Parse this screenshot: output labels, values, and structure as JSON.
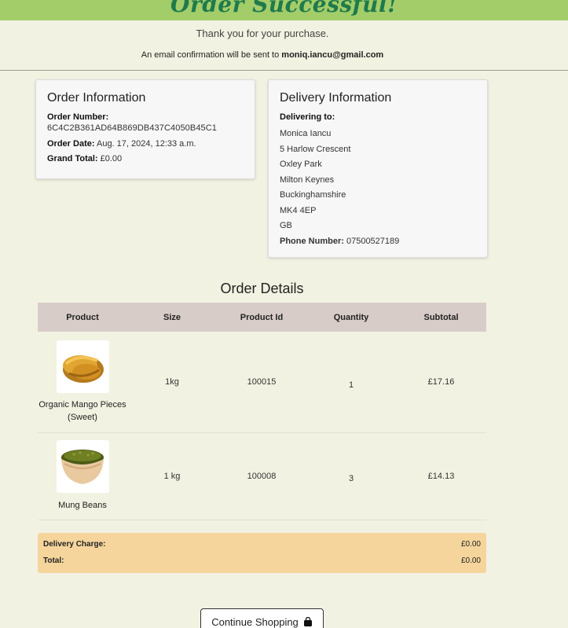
{
  "banner": {
    "title": "Order Successful!"
  },
  "header": {
    "thanks": "Thank you for your purchase.",
    "email_prefix": "An email confirmation will be sent to ",
    "email": "moniq.iancu@gmail.com"
  },
  "order_info": {
    "title": "Order Information",
    "number_label": "Order Number:",
    "number": "6C4C2B361AD64B869DB437C4050B45C1",
    "date_label": "Order Date:",
    "date": "Aug. 17, 2024, 12:33 a.m.",
    "total_label": "Grand Total:",
    "total": "£0.00"
  },
  "delivery_info": {
    "title": "Delivery Information",
    "to_label": "Delivering to:",
    "address": [
      "Monica Iancu",
      "5 Harlow Crescent",
      "Oxley Park",
      "Milton Keynes",
      "Buckinghamshire",
      "MK4 4EP",
      "GB"
    ],
    "phone_label": "Phone Number:",
    "phone": "07500527189"
  },
  "details": {
    "title": "Order Details",
    "headers": [
      "Product",
      "Size",
      "Product Id",
      "Quantity",
      "Subtotal"
    ],
    "rows": [
      {
        "name": "Organic Mango Pieces (Sweet)",
        "size": "1kg",
        "id": "100015",
        "qty": "1",
        "subtotal": "£17.16",
        "image_icon": "dried-mango-icon"
      },
      {
        "name": "Mung Beans",
        "size": "1 kg",
        "id": "100008",
        "qty": "3",
        "subtotal": "£14.13",
        "image_icon": "mung-beans-bowl-icon"
      }
    ]
  },
  "summary": {
    "delivery_label": "Delivery Charge:",
    "delivery": "£0.00",
    "total_label": "Total:",
    "total": "£0.00"
  },
  "actions": {
    "continue_label": "Continue Shopping",
    "bag_icon": "shopping-bag-icon"
  },
  "colors": {
    "banner": "#a3cd69",
    "banner_text": "#1f7a4c",
    "page_bg": "#f2f2e2",
    "table_header": "#d8ccc8",
    "summary_bg": "#f5d59c"
  }
}
